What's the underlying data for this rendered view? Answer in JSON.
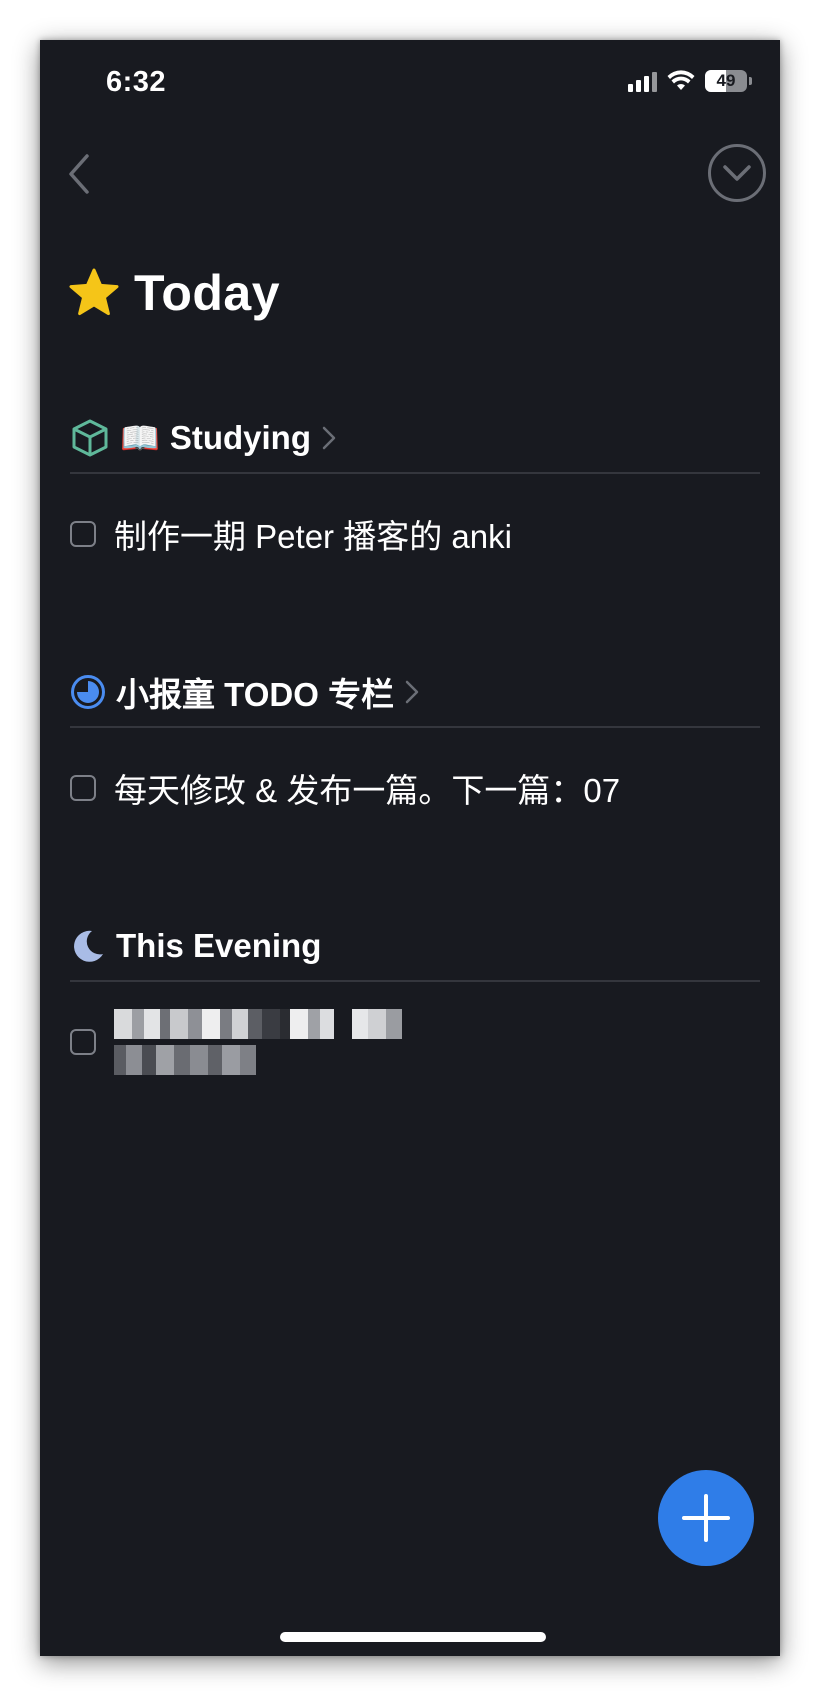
{
  "status_bar": {
    "time": "6:32",
    "battery": "49",
    "battery_level": 0.49
  },
  "nav": {
    "back_icon": "chevron-left-icon",
    "done_icon": "checkmark-circle-icon"
  },
  "header": {
    "icon": "star-icon",
    "title": "Today"
  },
  "sections": [
    {
      "icon": "cube-icon",
      "emoji": "📖",
      "title": "Studying",
      "has_chevron": true,
      "tasks": [
        {
          "text": "制作一期 Peter 播客的 anki",
          "checked": false
        }
      ]
    },
    {
      "icon": "progress-pie-icon",
      "title": "小报童 TODO 专栏",
      "has_chevron": true,
      "tasks": [
        {
          "text": "每天修改 & 发布一篇。下一篇：07",
          "checked": false
        }
      ]
    },
    {
      "icon": "moon-icon",
      "title": "This Evening",
      "has_chevron": false,
      "tasks": [
        {
          "text": "",
          "checked": false,
          "redacted": true
        }
      ]
    }
  ],
  "colors": {
    "background": "#181a20",
    "accent": "#2f7de8",
    "star": "#f5c518",
    "cube": "#5fb89a",
    "pie": "#4a8cf0",
    "moon": "#a9bce6",
    "divider": "#34363d"
  },
  "fab": {
    "icon": "plus-icon"
  }
}
